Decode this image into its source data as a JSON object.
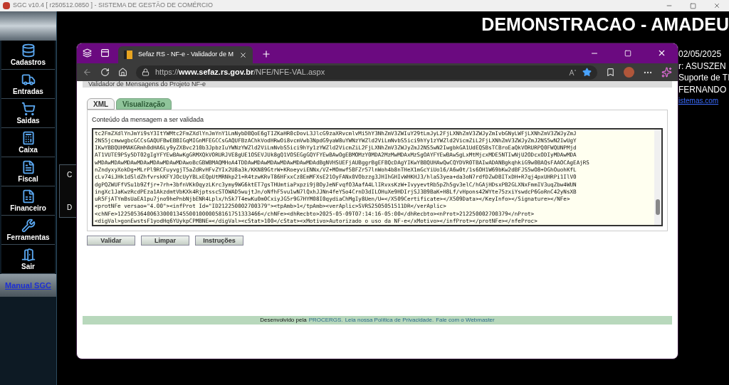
{
  "app_window": {
    "title": "SGC v10.4 [ r250512.0850 ] - SISTEMA DE GESTÃO DE COMÉRCIO"
  },
  "sidebar": {
    "items": [
      {
        "label": "Cadastros",
        "kind": "database"
      },
      {
        "label": "Entradas",
        "kind": "truck"
      },
      {
        "label": "Saidas",
        "kind": "cart"
      },
      {
        "label": "Caixa",
        "kind": "register"
      },
      {
        "label": "Fiscal",
        "kind": "document"
      },
      {
        "label": "Financeiro",
        "kind": "sheet"
      },
      {
        "label": "Ferramentas",
        "kind": "tools"
      },
      {
        "label": "Sair",
        "kind": "exit"
      }
    ],
    "manual_link": "Manual SGC"
  },
  "header": {
    "company": "DEMONSTRACAO - AMADEU",
    "info_lines": [
      "02/05/2025",
      "r: ASUSZEN",
      "Suporte de TI",
      "FERNANDO"
    ],
    "link": "istemas.com"
  },
  "background_panel": {
    "labels": [
      "C",
      "D"
    ]
  },
  "browser": {
    "tab_title": "Sefaz RS - NF-e - Validador de M",
    "url": {
      "scheme": "https://",
      "domain": "www.sefaz.rs.gov.br",
      "path": "/NFE/NFE-VAL.aspx"
    }
  },
  "page": {
    "heading": "Validador de Mensagens do Projeto NF-e",
    "tabs": [
      {
        "label": "XML",
        "selected": true
      },
      {
        "label": "Visualização",
        "selected": false
      }
    ],
    "field_label": "Conteúdo da mensagem a ser validada",
    "message_lines": [
      "tc2FmZXdlYnJmYi9sY3ItYWMtc2FmZXdlYnJmYnY1LmNybDBQoE6gTIZKaHR0cDovL3JlcG9zaXRvcmlvMi5hY3NhZmV3ZWIuY29tLmJyL2FjLXNhZmV3ZWJyZmIvbGNyLWFjLXNhZmV3ZWJyZmJ",
      "2NS5jcmwwgbcGCCsGAQUFBwEBBIGqMIGnMFEGCCsGAQUFBzAChkVodHRwOi8vcmVwb3NpdG9yaW8uYWNzYWZld2ViLmNvbS5ici9hYy1zYWZld2VicmZiL2FjLXNhZmV3ZWJyZmJ2NS5wN2IwUgY",
      "IKwYBBQUHMAKGRmh0dHA6Ly9yZXBvc210b3JpbzIuYWNzYWZld2ViLmNvbS5ici9hYy1zYWZld2VicmZiL2FjLXNhZmV3ZWJyZmJ2NS5wN2IwgbkGA1UdEQSBsTCBroEaQkVORURPQ0FWQUNPMjd",
      "AT1VUTE9PSy5DT02gIgYFYEwBAwKgGRMXQkVORURJVE8gUE1OSEVJUk8gQ1VOSEGgGQYFYEwBAwOgEBMOMzY0MDA2MzMwMDAxMzSgOAYFYEwBAwSgLxMtMjcxMDE5NTIwNjU2ODcxODIyMDAwMDA",
      "wMDAwMDAwMDAwMDAwMDAwMDAwMDAwoBcGBWBMAQMHoA4TDDAwMDAwMDAwMDAwMDAwMDAdBgNVHSUEFjAUBggrBgEFBQcDAgYIKwYBBQUHAwQwCQYDVR0TBAIwADANBgkqhkiG9w0BAQsFAAOCAgEAjRS",
      "nZndyxyXokDg+MLrPl9RCFuyvgjT5aZdRvHFvZYIx2U8a3k/KKN89GtrW+KRoeyviENNx/VZ+MOmwf5BFZr57lnWoh4b8nTHeX1mGcYiUo16/A6w0t/1s6OH1W69bKw2dBFJS5wO8+DGhOuohKfL",
      "cLv74iJHk1dSldZhfvrskKFYJOcUyYBLxEQpUtMRNkp21+R4tzwKRvT86HFxxCz8EmMFXsE21OyFANx0VObzzg3JHIhGHIvWHKHJ3/hlaS3yea+da3oN7rdfDZwDBITxDH+R7qj4pxUHRPi1IlV0",
      "dgPQZWUFfVSu1b9Zfjr+7rh+3bfnVKk0qyzLKrc3ymy9WG6ktET7gsTHUmtiaPxpzi9jBOyJeNFvqfO3AafA4LlIRvxsKzW+IvyyevtRb5pZh5gv3elC/hGAjHDsxPB2GLXNxFmmIV3uqZbw4WUN",
      "ingXc1JaKwzRcdPEza1AkzdmtVbKXk4RjptsscSTOWAD5wujtJn/oNfhF5vu1wN7lQxhJJNn4feYSo4CrnD3dILOHuXe9HDIrjSJ3B9BaK+H8Lf/vHpons42WYte75zxiYswdcP6GoRnC42yNsXB",
      "uR5FjATYmBsUaEA1pu7jno9hePnbNjbENR4Lplx/hSk7T4ewKu0m0CxiyJG5r9G7HYM08I0qydiaChMgIy8Uen/U=</X509Certificate></X509Data></KeyInfo></Signature></NFe>",
      "<protNFe versao=\"4.00\"><infProt Id=\"ID212250002700379\"><tpAmb>1</tpAmb><verAplic>SVRS2505051511DR</verAplic>",
      "<chNFe>12250536400633000134550010000058161751333466</chNFe><dhRecbto>2025-05-09T07:14:16-05:00</dhRecbto><nProt>212250002700379</nProt>",
      "<digVal>gonEwstsF1yodHq6YUykpCPMBNE=</digVal><cStat>100</cStat><xMotivo>Autorizado o uso da NF-e</xMotivo></infProt></protNFe></nfeProc>"
    ],
    "buttons": [
      "Validar",
      "Limpar",
      "Instruções"
    ],
    "footer": {
      "prefix": "Desenvolvido pela",
      "links": [
        "PROCERGS.",
        "Leia nossa Política de Privacidade.",
        "Fale com o Webmaster"
      ]
    }
  }
}
